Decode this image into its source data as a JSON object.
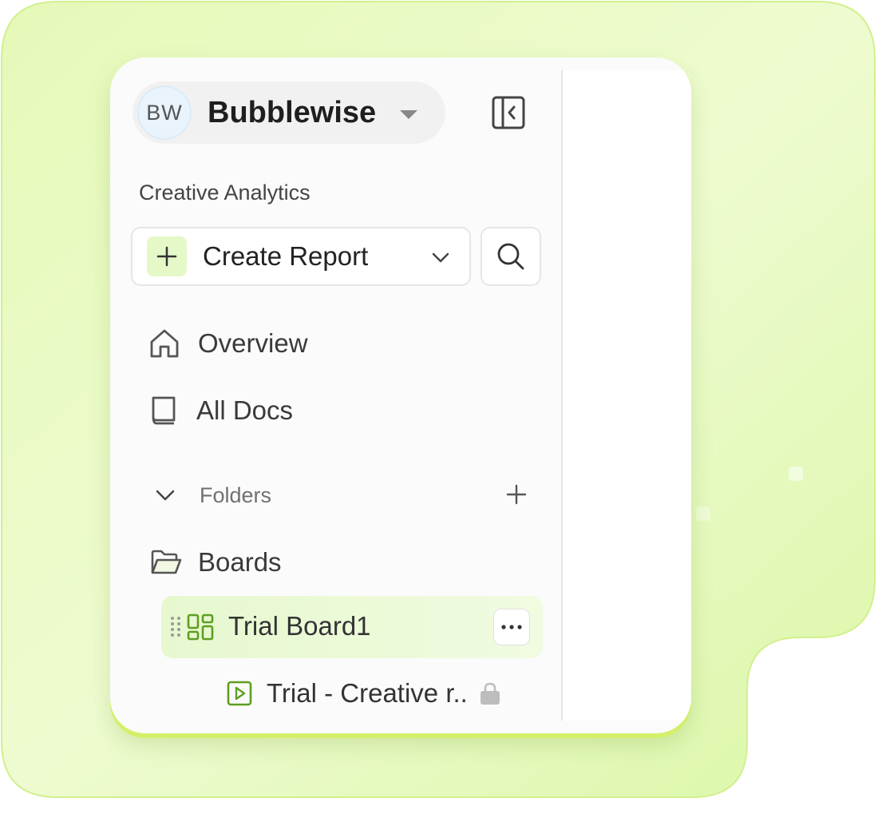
{
  "workspace": {
    "initials": "BW",
    "name": "Bubblewise",
    "dropdown_icon": "caret-down-icon"
  },
  "sidebar": {
    "collapse_icon": "sidebar-collapse-icon",
    "section_label": "Creative Analytics",
    "create_button": {
      "label": "Create Report",
      "icon": "plus-icon",
      "chevron": "chevron-down-icon"
    },
    "search_icon": "search-icon",
    "nav_items": [
      {
        "label": "Overview",
        "icon": "home-icon"
      },
      {
        "label": "All Docs",
        "icon": "book-icon"
      }
    ],
    "folders": {
      "label": "Folders",
      "toggle_icon": "chevron-down-icon",
      "add_icon": "plus-icon",
      "items": [
        {
          "label": "Boards",
          "icon": "folder-open-icon",
          "children": [
            {
              "label": "Trial Board1",
              "icon": "board-grid-icon",
              "selected": true,
              "more_icon": "more-horizontal-icon",
              "children": [
                {
                  "label": "Trial - Creative r..",
                  "icon": "play-square-icon",
                  "locked": true,
                  "lock_icon": "lock-icon"
                }
              ]
            }
          ]
        }
      ]
    }
  },
  "colors": {
    "accent_green": "#6aa52a",
    "accent_tile": "#e5f8c8",
    "selected_row": "#e7f8cf",
    "backdrop": "#e3f9b4"
  }
}
